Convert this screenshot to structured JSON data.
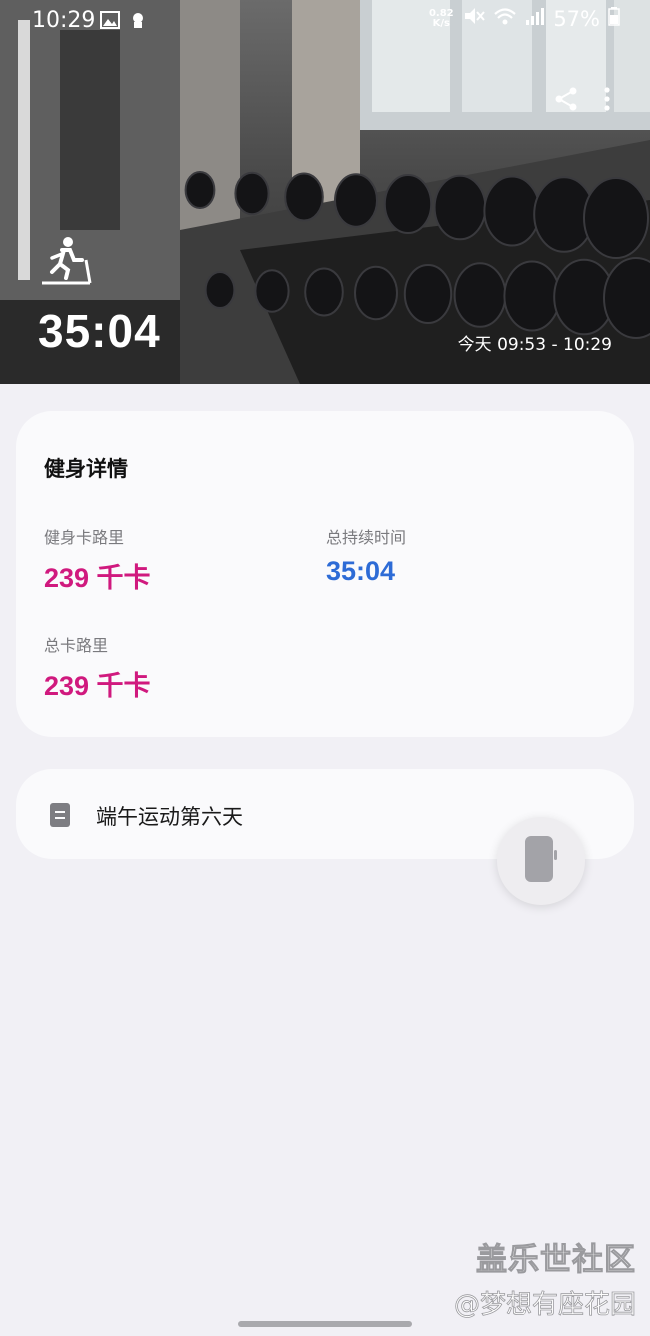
{
  "status_bar": {
    "time": "10:29",
    "net_speed_value": "0.82",
    "net_speed_unit": "K/s",
    "battery": "57%",
    "icons": [
      "image-icon",
      "notification-icon",
      "mute-icon",
      "wifi-icon",
      "signal-icon",
      "battery-icon"
    ]
  },
  "hero": {
    "activity_icon": "treadmill-icon",
    "duration": "35:04",
    "time_range": "今天 09:53 - 10:29",
    "actions": [
      "share-icon",
      "more-icon"
    ]
  },
  "detail": {
    "title": "健身详情",
    "metrics": [
      {
        "label": "健身卡路里",
        "value": "239 千卡",
        "color": "#d0197e"
      },
      {
        "label": "总持续时间",
        "value": "35:04",
        "color": "#2d6bd6"
      },
      {
        "label": "总卡路里",
        "value": "239 千卡",
        "color": "#d0197e"
      }
    ]
  },
  "note": {
    "icon": "note-icon",
    "text": "端午运动第六天"
  },
  "fab": {
    "icon": "watch-icon"
  },
  "watermark": {
    "brand": "盖乐世社区",
    "sub": "@梦想有座花园"
  }
}
